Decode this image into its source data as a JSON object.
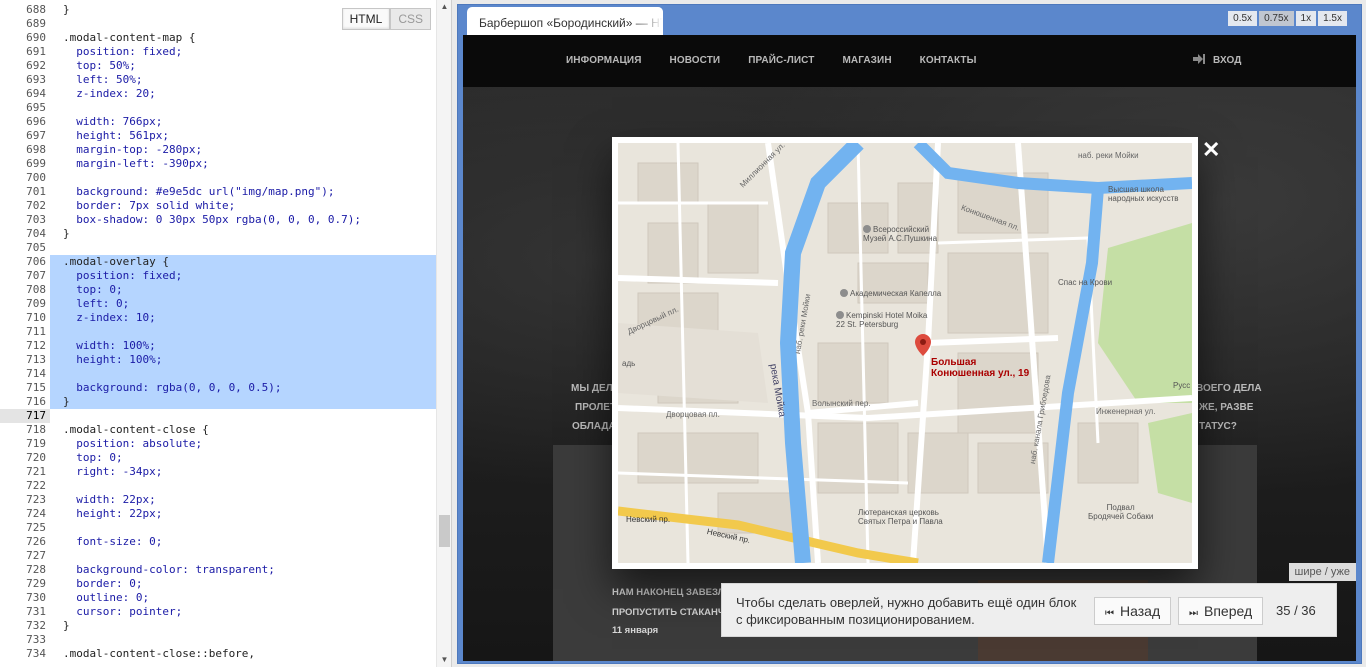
{
  "editor": {
    "mode_tabs": [
      "HTML",
      "CSS"
    ],
    "lines": [
      {
        "n": "688",
        "t": "}"
      },
      {
        "n": "689",
        "t": ""
      },
      {
        "n": "690",
        "t": ".modal-content-map {"
      },
      {
        "n": "691",
        "t": "  position: fixed;"
      },
      {
        "n": "692",
        "t": "  top: 50%;"
      },
      {
        "n": "693",
        "t": "  left: 50%;"
      },
      {
        "n": "694",
        "t": "  z-index: 20;"
      },
      {
        "n": "695",
        "t": ""
      },
      {
        "n": "696",
        "t": "  width: 766px;"
      },
      {
        "n": "697",
        "t": "  height: 561px;"
      },
      {
        "n": "698",
        "t": "  margin-top: -280px;"
      },
      {
        "n": "699",
        "t": "  margin-left: -390px;"
      },
      {
        "n": "700",
        "t": ""
      },
      {
        "n": "701",
        "t": "  background: #e9e5dc url(\"img/map.png\");"
      },
      {
        "n": "702",
        "t": "  border: 7px solid white;"
      },
      {
        "n": "703",
        "t": "  box-shadow: 0 30px 50px rgba(0, 0, 0, 0.7);"
      },
      {
        "n": "704",
        "t": "}"
      },
      {
        "n": "705",
        "t": ""
      },
      {
        "n": "706",
        "t": ".modal-overlay {"
      },
      {
        "n": "707",
        "t": "  position: fixed;"
      },
      {
        "n": "708",
        "t": "  top: 0;"
      },
      {
        "n": "709",
        "t": "  left: 0;"
      },
      {
        "n": "710",
        "t": "  z-index: 10;"
      },
      {
        "n": "711",
        "t": ""
      },
      {
        "n": "712",
        "t": "  width: 100%;"
      },
      {
        "n": "713",
        "t": "  height: 100%;"
      },
      {
        "n": "714",
        "t": ""
      },
      {
        "n": "715",
        "t": "  background: rgba(0, 0, 0, 0.5);"
      },
      {
        "n": "716",
        "t": "}"
      },
      {
        "n": "717",
        "t": ""
      },
      {
        "n": "718",
        "t": ".modal-content-close {"
      },
      {
        "n": "719",
        "t": "  position: absolute;"
      },
      {
        "n": "720",
        "t": "  top: 0;"
      },
      {
        "n": "721",
        "t": "  right: -34px;"
      },
      {
        "n": "722",
        "t": ""
      },
      {
        "n": "723",
        "t": "  width: 22px;"
      },
      {
        "n": "724",
        "t": "  height: 22px;"
      },
      {
        "n": "725",
        "t": ""
      },
      {
        "n": "726",
        "t": "  font-size: 0;"
      },
      {
        "n": "727",
        "t": ""
      },
      {
        "n": "728",
        "t": "  background-color: transparent;"
      },
      {
        "n": "729",
        "t": "  border: 0;"
      },
      {
        "n": "730",
        "t": "  outline: 0;"
      },
      {
        "n": "731",
        "t": "  cursor: pointer;"
      },
      {
        "n": "732",
        "t": "}"
      },
      {
        "n": "733",
        "t": ""
      },
      {
        "n": "734",
        "t": ".modal-content-close::before,"
      }
    ],
    "highlight_from": "706",
    "highlight_to": "716",
    "current_line": "717"
  },
  "browser": {
    "tab_title": "Барбершоп «Бородинский» — HTML",
    "zoom_options": [
      "0.5x",
      "0.75x",
      "1x",
      "1.5x"
    ],
    "zoom_selected": "0.75x",
    "site": {
      "nav": [
        "ИНФОРМАЦИЯ",
        "НОВОСТИ",
        "ПРАЙС-ЛИСТ",
        "МАГАЗИН",
        "КОНТАКТЫ"
      ],
      "login": "ВХОД",
      "hero_left": [
        "МЫ ДЕЛАЕ",
        "ПРОЛЕТЯ",
        "ОБЛАДАТ"
      ],
      "hero_right": [
        "ВОЕГО ДЕЛА",
        "ЖЕ, РАЗВЕ",
        "ТАТУС?"
      ],
      "news_title_1": "НАМ НАКОНЕЦ ЗАВЕЗЛИ ЯГ",
      "news_title_2": "ПРОПУСТИТЬ СТАКАНЧИК Е",
      "news_date": "11 января"
    },
    "map": {
      "labels": {
        "moika_top": "наб. реки Мойки",
        "school": "Высшая школа\nнародных искусств",
        "konyushennaya_pl": "Конюшенная пл.",
        "pushkin": "Всероссийский\nМузей А.С.Пушкина",
        "spas": "Спас на Крови",
        "capella": "Академическая Капелла",
        "kempinski": "Kempinski Hotel Moika\n22 St. Petersburg",
        "pin": "Большая\nКонюшенная ул., 19",
        "russ": "Русс",
        "volynsky": "Волынский пер.",
        "inzhenernaya": "Инженерная ул.",
        "dvortsovy_1": "Дворцовый пл.",
        "dvortsovy_2": "Дворцовая пл.",
        "lutheran": "Лютеранская церковь\nСвятых Петра и Павла",
        "podval": "Подвал\nБродячей Собаки",
        "nevsky_1": "Невский пр.",
        "nevsky_2": "Невский пр.",
        "moika_river": "река Мойка",
        "moika_emb": "наб. реки Мойки",
        "griboedova": "наб. канала Грибоедова",
        "millionnaya": "Миллионная ул.",
        "kanal": "наб. канал",
        "iskusstv": "пл. Искусств",
        "konyushennaya_ul": "Конюшенная ул.",
        "ad": "адь"
      }
    },
    "tip": {
      "text": "Чтобы сделать оверлей, нужно добавить ещё один блок с фиксированным позиционированием.",
      "back": "Назад",
      "forward": "Вперед",
      "counter": "35 / 36",
      "wider": "шире / уже"
    }
  }
}
